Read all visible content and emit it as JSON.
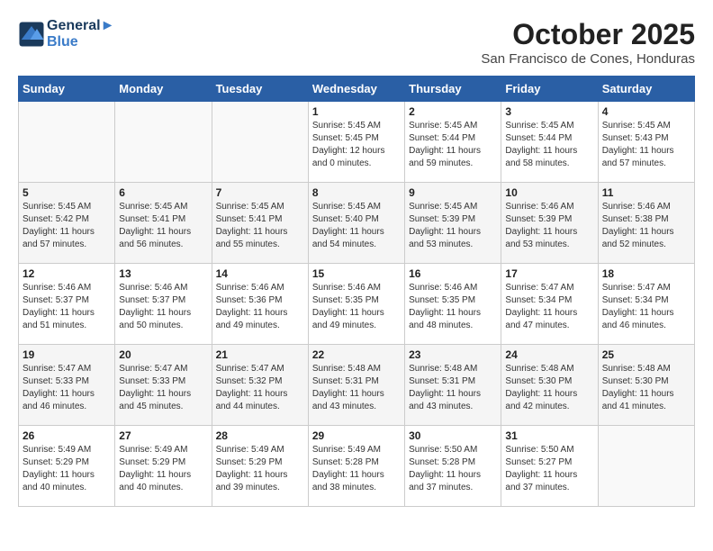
{
  "header": {
    "logo_line1": "General",
    "logo_line2": "Blue",
    "month_title": "October 2025",
    "subtitle": "San Francisco de Cones, Honduras"
  },
  "days_of_week": [
    "Sunday",
    "Monday",
    "Tuesday",
    "Wednesday",
    "Thursday",
    "Friday",
    "Saturday"
  ],
  "weeks": [
    [
      {
        "day": "",
        "info": ""
      },
      {
        "day": "",
        "info": ""
      },
      {
        "day": "",
        "info": ""
      },
      {
        "day": "1",
        "info": "Sunrise: 5:45 AM\nSunset: 5:45 PM\nDaylight: 12 hours\nand 0 minutes."
      },
      {
        "day": "2",
        "info": "Sunrise: 5:45 AM\nSunset: 5:44 PM\nDaylight: 11 hours\nand 59 minutes."
      },
      {
        "day": "3",
        "info": "Sunrise: 5:45 AM\nSunset: 5:44 PM\nDaylight: 11 hours\nand 58 minutes."
      },
      {
        "day": "4",
        "info": "Sunrise: 5:45 AM\nSunset: 5:43 PM\nDaylight: 11 hours\nand 57 minutes."
      }
    ],
    [
      {
        "day": "5",
        "info": "Sunrise: 5:45 AM\nSunset: 5:42 PM\nDaylight: 11 hours\nand 57 minutes."
      },
      {
        "day": "6",
        "info": "Sunrise: 5:45 AM\nSunset: 5:41 PM\nDaylight: 11 hours\nand 56 minutes."
      },
      {
        "day": "7",
        "info": "Sunrise: 5:45 AM\nSunset: 5:41 PM\nDaylight: 11 hours\nand 55 minutes."
      },
      {
        "day": "8",
        "info": "Sunrise: 5:45 AM\nSunset: 5:40 PM\nDaylight: 11 hours\nand 54 minutes."
      },
      {
        "day": "9",
        "info": "Sunrise: 5:45 AM\nSunset: 5:39 PM\nDaylight: 11 hours\nand 53 minutes."
      },
      {
        "day": "10",
        "info": "Sunrise: 5:46 AM\nSunset: 5:39 PM\nDaylight: 11 hours\nand 53 minutes."
      },
      {
        "day": "11",
        "info": "Sunrise: 5:46 AM\nSunset: 5:38 PM\nDaylight: 11 hours\nand 52 minutes."
      }
    ],
    [
      {
        "day": "12",
        "info": "Sunrise: 5:46 AM\nSunset: 5:37 PM\nDaylight: 11 hours\nand 51 minutes."
      },
      {
        "day": "13",
        "info": "Sunrise: 5:46 AM\nSunset: 5:37 PM\nDaylight: 11 hours\nand 50 minutes."
      },
      {
        "day": "14",
        "info": "Sunrise: 5:46 AM\nSunset: 5:36 PM\nDaylight: 11 hours\nand 49 minutes."
      },
      {
        "day": "15",
        "info": "Sunrise: 5:46 AM\nSunset: 5:35 PM\nDaylight: 11 hours\nand 49 minutes."
      },
      {
        "day": "16",
        "info": "Sunrise: 5:46 AM\nSunset: 5:35 PM\nDaylight: 11 hours\nand 48 minutes."
      },
      {
        "day": "17",
        "info": "Sunrise: 5:47 AM\nSunset: 5:34 PM\nDaylight: 11 hours\nand 47 minutes."
      },
      {
        "day": "18",
        "info": "Sunrise: 5:47 AM\nSunset: 5:34 PM\nDaylight: 11 hours\nand 46 minutes."
      }
    ],
    [
      {
        "day": "19",
        "info": "Sunrise: 5:47 AM\nSunset: 5:33 PM\nDaylight: 11 hours\nand 46 minutes."
      },
      {
        "day": "20",
        "info": "Sunrise: 5:47 AM\nSunset: 5:33 PM\nDaylight: 11 hours\nand 45 minutes."
      },
      {
        "day": "21",
        "info": "Sunrise: 5:47 AM\nSunset: 5:32 PM\nDaylight: 11 hours\nand 44 minutes."
      },
      {
        "day": "22",
        "info": "Sunrise: 5:48 AM\nSunset: 5:31 PM\nDaylight: 11 hours\nand 43 minutes."
      },
      {
        "day": "23",
        "info": "Sunrise: 5:48 AM\nSunset: 5:31 PM\nDaylight: 11 hours\nand 43 minutes."
      },
      {
        "day": "24",
        "info": "Sunrise: 5:48 AM\nSunset: 5:30 PM\nDaylight: 11 hours\nand 42 minutes."
      },
      {
        "day": "25",
        "info": "Sunrise: 5:48 AM\nSunset: 5:30 PM\nDaylight: 11 hours\nand 41 minutes."
      }
    ],
    [
      {
        "day": "26",
        "info": "Sunrise: 5:49 AM\nSunset: 5:29 PM\nDaylight: 11 hours\nand 40 minutes."
      },
      {
        "day": "27",
        "info": "Sunrise: 5:49 AM\nSunset: 5:29 PM\nDaylight: 11 hours\nand 40 minutes."
      },
      {
        "day": "28",
        "info": "Sunrise: 5:49 AM\nSunset: 5:29 PM\nDaylight: 11 hours\nand 39 minutes."
      },
      {
        "day": "29",
        "info": "Sunrise: 5:49 AM\nSunset: 5:28 PM\nDaylight: 11 hours\nand 38 minutes."
      },
      {
        "day": "30",
        "info": "Sunrise: 5:50 AM\nSunset: 5:28 PM\nDaylight: 11 hours\nand 37 minutes."
      },
      {
        "day": "31",
        "info": "Sunrise: 5:50 AM\nSunset: 5:27 PM\nDaylight: 11 hours\nand 37 minutes."
      },
      {
        "day": "",
        "info": ""
      }
    ]
  ]
}
